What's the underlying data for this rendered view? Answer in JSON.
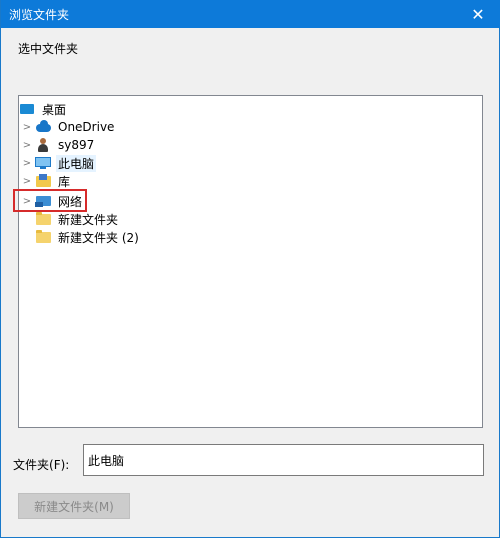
{
  "window": {
    "title": "浏览文件夹",
    "close_glyph": "✕"
  },
  "instruction": "选中文件夹",
  "tree": {
    "items": [
      {
        "label": "桌面",
        "icon": "desktop-icon",
        "expandable": false
      },
      {
        "label": "OneDrive",
        "icon": "onedrive-cloud-icon",
        "expandable": true
      },
      {
        "label": "sy897",
        "icon": "user-icon",
        "expandable": true
      },
      {
        "label": "此电脑",
        "icon": "computer-icon",
        "expandable": true,
        "selected": true
      },
      {
        "label": "库",
        "icon": "library-icon",
        "expandable": true
      },
      {
        "label": "网络",
        "icon": "network-icon",
        "expandable": true,
        "highlighted": true
      },
      {
        "label": "新建文件夹",
        "icon": "folder-icon",
        "expandable": false
      },
      {
        "label": "新建文件夹 (2)",
        "icon": "folder-icon",
        "expandable": false
      }
    ]
  },
  "folder_field": {
    "label": "文件夹",
    "label_shortcut": "(F):",
    "value": "此电脑"
  },
  "buttons": {
    "new_folder": "新建文件夹(M)"
  },
  "colors": {
    "titlebar": "#0d7ad9",
    "highlight_border": "#d62b2b",
    "selection": "#e5f3ff"
  }
}
